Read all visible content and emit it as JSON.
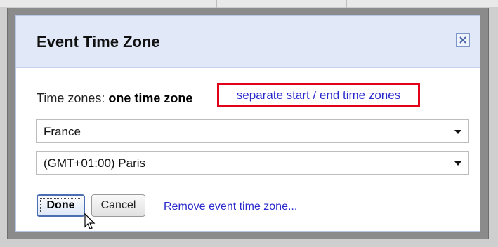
{
  "dialog": {
    "title": "Event Time Zone",
    "close_icon": "close-icon",
    "time_zones_label": "Time zones:",
    "one_time_zone": "one time zone",
    "separate_link": "separate start / end time zones",
    "country_select": {
      "value": "France"
    },
    "timezone_select": {
      "value": "(GMT+01:00) Paris"
    },
    "done_label": "Done",
    "cancel_label": "Cancel",
    "remove_link": "Remove event time zone..."
  },
  "colors": {
    "accent_link": "#2a2acc",
    "highlight_border": "#e3001b",
    "header_bg": "#e1e9f9"
  }
}
